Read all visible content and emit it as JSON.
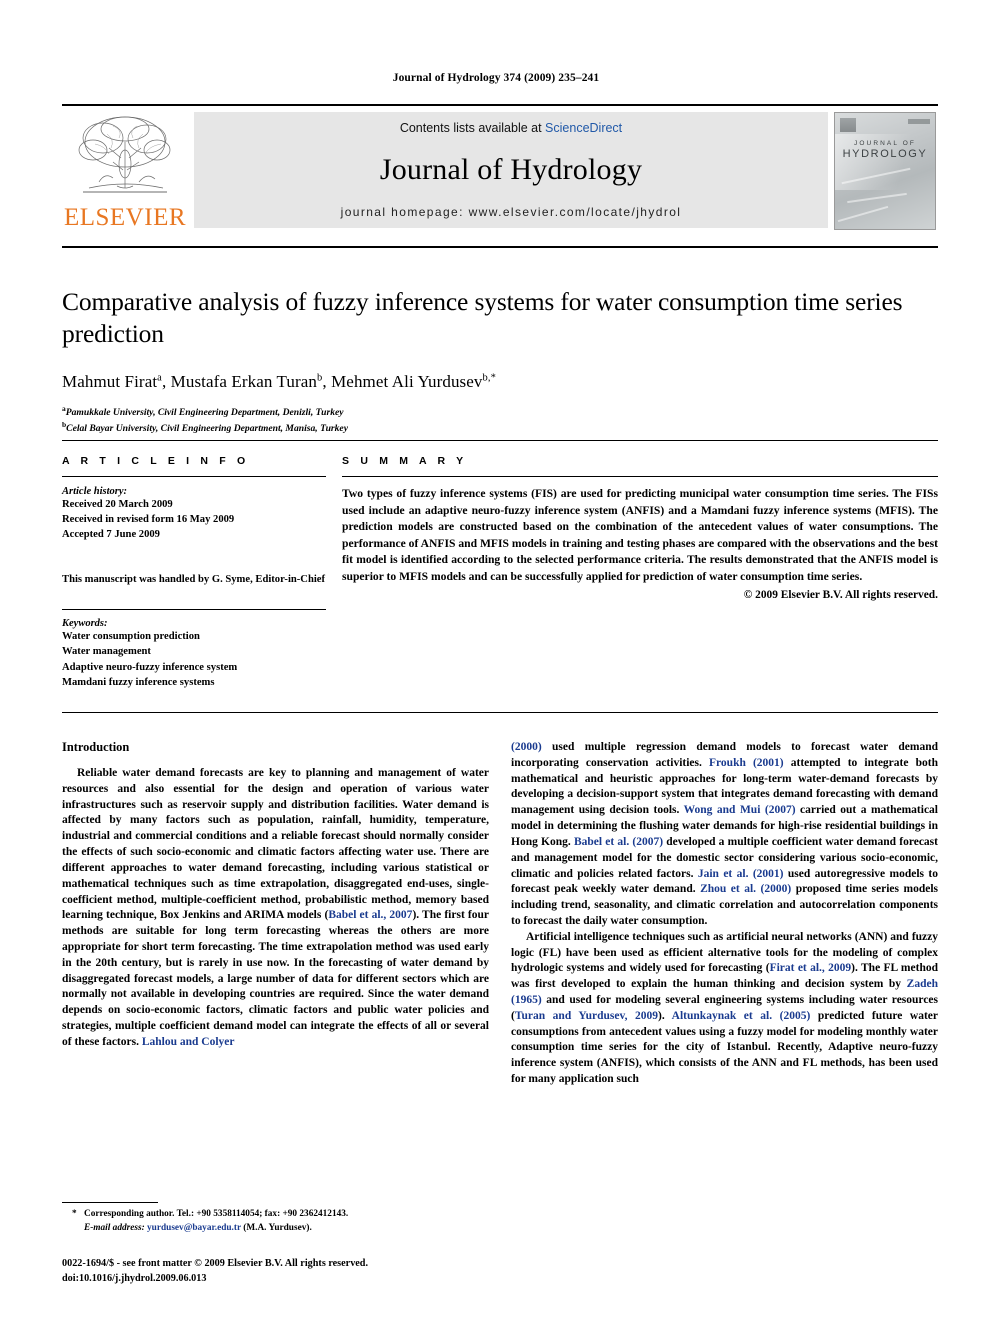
{
  "running_head": "Journal of Hydrology 374 (2009) 235–241",
  "masthead": {
    "contents_prefix": "Contents lists available at ",
    "sciencedirect": "ScienceDirect",
    "journal_title": "Journal of Hydrology",
    "homepage": "journal homepage: www.elsevier.com/locate/jhydrol",
    "publisher_wordmark": "ELSEVIER",
    "cover_line1": "JOURNAL OF",
    "cover_line2": "HYDROLOGY",
    "accent_orange": "#E87722",
    "link_blue": "#2159a8"
  },
  "article": {
    "title": "Comparative analysis of fuzzy inference systems for water consumption time series prediction",
    "authors": "Mahmut Firat a, Mustafa Erkan Turan b, Mehmet Ali Yurdusev b,*",
    "author_parts": [
      {
        "name": "Mahmut Firat",
        "sup": "a",
        "sep": ", "
      },
      {
        "name": "Mustafa Erkan Turan",
        "sup": "b",
        "sep": ", "
      },
      {
        "name": "Mehmet Ali Yurdusev",
        "sup": "b,*",
        "sep": ""
      }
    ],
    "affiliations": [
      {
        "mark": "a",
        "text": "Pamukkale University, Civil Engineering Department, Denizli, Turkey"
      },
      {
        "mark": "b",
        "text": "Celal Bayar University, Civil Engineering Department, Manisa, Turkey"
      }
    ]
  },
  "article_info": {
    "heading": "A R T I C L E   I N F O",
    "history_label": "Article history:",
    "history": [
      "Received 20 March 2009",
      "Received in revised form 16 May 2009",
      "Accepted 7 June 2009"
    ],
    "handled_by": "This manuscript was handled by G. Syme, Editor-in-Chief",
    "keywords_label": "Keywords:",
    "keywords": [
      "Water consumption prediction",
      "Water management",
      "Adaptive neuro-fuzzy inference system",
      "Mamdani fuzzy inference systems"
    ]
  },
  "summary": {
    "heading": "S U M M A R Y",
    "text": "Two types of fuzzy inference systems (FIS) are used for predicting municipal water consumption time series. The FISs used include an adaptive neuro-fuzzy inference system (ANFIS) and a Mamdani fuzzy inference systems (MFIS). The prediction models are constructed based on the combination of the antecedent values of water consumptions. The performance of ANFIS and MFIS models in training and testing phases are compared with the observations and the best fit model is identified according to the selected performance criteria. The results demonstrated that the ANFIS model is superior to MFIS models and can be successfully applied for prediction of water consumption time series.",
    "copyright": "© 2009 Elsevier B.V. All rights reserved."
  },
  "body": {
    "section_heading": "Introduction",
    "left_p1_a": "Reliable water demand forecasts are key to planning and management of water resources and also essential for the design and operation of various water infrastructures such as reservoir supply and distribution facilities. Water demand is affected by many factors such as population, rainfall, humidity, temperature, industrial and commercial conditions and a reliable forecast should normally consider the effects of such socio-economic and climatic factors affecting water use. There are different approaches to water demand forecasting, including various statistical or mathematical techniques such as time extrapolation, disaggregated end-uses, single-coefficient method, multiple-coefficient method, probabilistic method, memory based learning technique, Box Jenkins and ARIMA models (",
    "left_cite1": "Babel et al., 2007",
    "left_p1_b": "). The first four methods are suitable for long term forecasting whereas the others are more appropriate for short term forecasting. The time extrapolation method was used early in the 20th century, but is rarely in use now. In the forecasting of water demand by disaggregated forecast models, a large number of data for different sectors which are normally not available in developing countries are required. Since the water demand depends on socio-economic factors, climatic factors and public water policies and strategies, multiple coefficient demand model can integrate the effects of all or several of these factors. ",
    "left_cite2": "Lahlou and Colyer",
    "right_cite0": "(2000)",
    "right_p1_a": " used multiple regression demand models to forecast water demand incorporating conservation activities. ",
    "right_cite1": "Froukh (2001)",
    "right_p1_b": " attempted to integrate both mathematical and heuristic approaches for long-term water-demand forecasts by developing a decision-support system that integrates demand forecasting with demand management using decision tools. ",
    "right_cite2": "Wong and Mui (2007)",
    "right_p1_c": " carried out a mathematical model in determining the flushing water demands for high-rise residential buildings in Hong Kong. ",
    "right_cite3": "Babel et al. (2007)",
    "right_p1_d": " developed a multiple coefficient water demand forecast and management model for the domestic sector considering various socio-economic, climatic and policies related factors. ",
    "right_cite4": "Jain et al. (2001)",
    "right_p1_e": " used autoregressive models to forecast peak weekly water demand. ",
    "right_cite5": "Zhou et al. (2000)",
    "right_p1_f": " proposed time series models including trend, seasonality, and climatic correlation and autocorrelation components to forecast the daily water consumption.",
    "right_p2_a": "Artificial intelligence techniques such as artificial neural networks (ANN) and fuzzy logic (FL) have been used as efficient alternative tools for the modeling of complex hydrologic systems and widely used for forecasting (",
    "right_cite6": "Firat et al., 2009",
    "right_p2_b": "). The FL method was first developed to explain the human thinking and decision system by ",
    "right_cite7": "Zadeh (1965)",
    "right_p2_c": " and used for modeling several engineering systems including water resources (",
    "right_cite8": "Turan and Yurdusev, 2009",
    "right_p2_d": "). ",
    "right_cite9": "Altunkaynak et al. (2005)",
    "right_p2_e": " predicted future water consumptions from antecedent values using a fuzzy model for modeling monthly water consumption time series for the city of Istanbul. Recently, Adaptive neuro-fuzzy inference system (ANFIS), which consists of the ANN and FL methods, has been used for many application such"
  },
  "footnotes": {
    "corresponding": "Corresponding author. Tel.: +90 5358114054; fax: +90 2362412143.",
    "email_label": "E-mail address:",
    "email": "yurdusev@bayar.edu.tr",
    "email_suffix": " (M.A. Yurdusev).",
    "front_matter": "0022-1694/$ - see front matter © 2009 Elsevier B.V. All rights reserved.",
    "doi": "doi:10.1016/j.jhydrol.2009.06.013"
  }
}
